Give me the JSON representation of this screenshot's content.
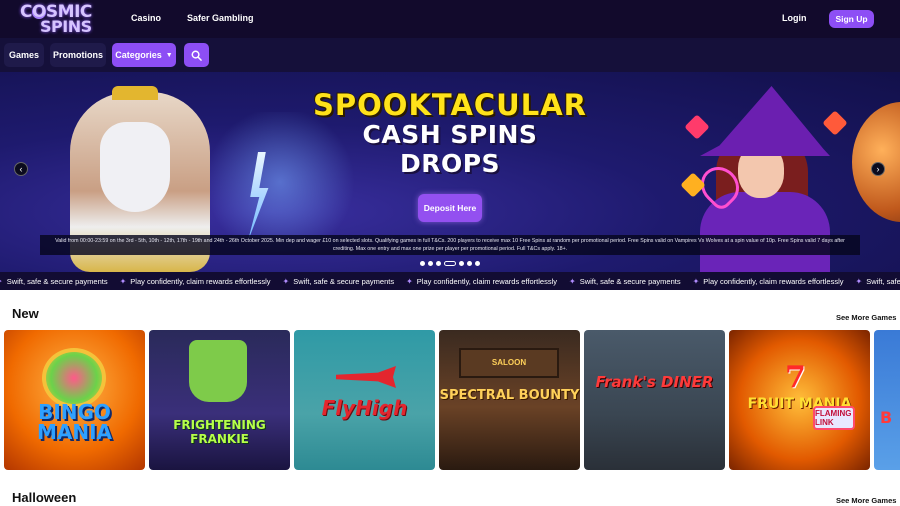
{
  "brand": {
    "logo_line1": "COSMIC",
    "logo_line2": "SPINS"
  },
  "topnav": {
    "casino": "Casino",
    "safer": "Safer Gambling",
    "login": "Login",
    "signup": "Sign Up"
  },
  "subnav": {
    "games": "Games",
    "promotions": "Promotions",
    "categories": "Categories",
    "caret": "▼"
  },
  "hero": {
    "title1": "SPOOKTACULAR",
    "title2": "CASH SPINS",
    "title3": "DROPS",
    "cta": "Deposit Here",
    "terms": "Valid from 00:00-23:59 on the 3rd - 5th, 10th - 12th, 17th - 19th and 24th - 26th October 2025. Min dep and wager £10 on selected slots. Qualifying games in full T&Cs. 200 players to receive max 10 Free Spins at random per promotional period. Free Spins valid on Vampires Vs Wolves at a spin value of 10p. Free Spins valid 7 days after crediting. Max one entry and max one prize per player per promotional period. Full T&Cs apply. 18+.",
    "slide_count": 7,
    "active_slide": 4,
    "prev": "‹",
    "next": "›"
  },
  "ticker": [
    "Swift, safe & secure payments",
    "Play confidently, claim rewards effortlessly",
    "Swift, safe & secure payments",
    "Play confidently, claim rewards effortlessly",
    "Swift, safe & secure payments",
    "Play confidently, claim rewards effortlessly",
    "Swift, safe & secure payments"
  ],
  "sections": {
    "new": {
      "title": "New",
      "see_more": "See More Games"
    },
    "halloween": {
      "title": "Halloween",
      "see_more": "See More Games"
    }
  },
  "games": [
    {
      "name": "BINGO MANIA"
    },
    {
      "name": "FRIGHTENING FRANKIE"
    },
    {
      "name": "FlyHigh"
    },
    {
      "name": "SPECTRAL BOUNTY",
      "sign": "SALOON"
    },
    {
      "name": "Frank's DINER"
    },
    {
      "name": "FRUIT MANIA",
      "badge": "FLAMING LINK"
    },
    {
      "name": "B"
    }
  ],
  "colors": {
    "accent": "#8d4ef5",
    "topbar": "#120a2c",
    "hero_title": "#ffe21a"
  },
  "icons": {
    "search": "search-icon",
    "ticker": "sparkle-icon"
  }
}
